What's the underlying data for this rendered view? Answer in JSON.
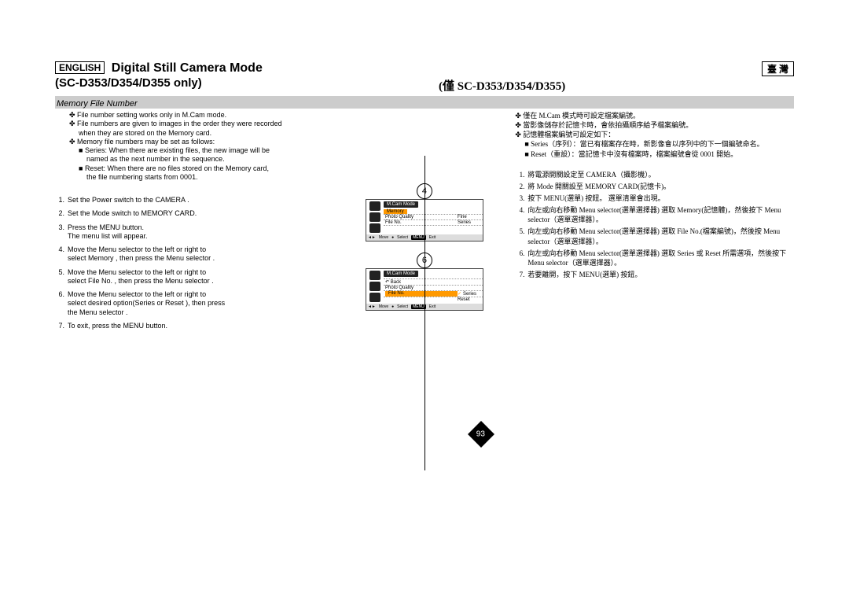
{
  "header": {
    "lang_left": "ENGLISH",
    "title_left": "Digital Still Camera Mode",
    "subtitle_left": "(SC-D353/D354/D355 only)",
    "lang_right": "臺 灣",
    "subtitle_right": "(僅 SC-D353/D354/D355)"
  },
  "section": {
    "left": "Memory File Number"
  },
  "intro_left": {
    "l1": "File number setting works only in M.Cam mode.",
    "l2": "File numbers are given to images in the order they were recorded",
    "l3": "when they are stored on the Memory card.",
    "l4": "Memory file numbers may be set as follows:",
    "l5": "Series: When there are existing files, the new image will be",
    "l6": "named as the next number in the sequence.",
    "l7": "Reset: When there are no files stored on the Memory card,",
    "l8": "the file numbering starts from 0001."
  },
  "steps_left": {
    "s1": "Set the Power switch to the CAMERA .",
    "s2": "Set the Mode switch to MEMORY CARD.",
    "s3a": "Press the MENU button.",
    "s3b": "The menu list will appear.",
    "s4a": "Move the Menu selector  to the left or right to",
    "s4b": "select Memory , then press the Menu selector .",
    "s5a": "Move the Menu selector  to the left or right to",
    "s5b": "select File No. , then press the Menu selector .",
    "s6a": "Move the Menu selector  to the left or right to",
    "s6b": "select desired option(Series  or Reset ), then press",
    "s6c": "the Menu selector .",
    "s7": "To exit, press the MENU button."
  },
  "intro_right": {
    "l1": "僅在 M.Cam 模式時可設定檔案編號。",
    "l2": "當影像儲存於記憶卡時，會依拍攝順序給予檔案編號。",
    "l3": "記憶體檔案編號可設定如下：",
    "l4": "Series（序列）：當已有檔案存在時，新影像會以序列中的下一個編號命名。",
    "l5": "Reset（重設）：當記憶卡中沒有檔案時，檔案編號會從 0001 開始。"
  },
  "steps_right": {
    "s1": "將電源開關設定至 CAMERA（攝影機）。",
    "s2": "將 Mode 開關設至 MEMORY CARD(記憶卡)。",
    "s3": "按下 MENU(選單) 按鈕。\n選單清單會出現。",
    "s4": "向左或向右移動 Menu selector(選單選擇器) 選取 Memory(記憶體)，然後按下 Menu selector（選單選擇器）。",
    "s5": "向左或向右移動 Menu selector(選單選擇器) 選取 File No.(檔案編號)，然後按 Menu selector（選單選擇器）。",
    "s6": "向左或向右移動 Menu selector(選單選擇器) 選取 Series 或 Reset 所需選項，然後按下 Menu selector（選單選擇器）。",
    "s7": "若要離開，按下 MENU(選單) 按鈕。"
  },
  "screens": {
    "a": {
      "title": "M.Cam Mode",
      "hl": "Memory",
      "row1l": "Photo Quality",
      "row1r": "Fine",
      "row2l": "File No.",
      "row2r": "Series",
      "foot": {
        "move": "Move",
        "select": "Select",
        "menu": "MENU",
        "exit": "Exit"
      }
    },
    "b": {
      "title": "M.Cam Mode",
      "back": "Back",
      "row1l": "Photo Quality",
      "hl": "File No.",
      "opt1": "Series",
      "opt2": "Reset",
      "foot": {
        "move": "Move",
        "select": "Select",
        "menu": "MENU",
        "exit": "Exit"
      }
    }
  },
  "circ": {
    "c4": "4",
    "c6": "6"
  },
  "page_number": "93"
}
